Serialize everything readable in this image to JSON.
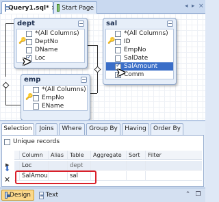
{
  "tabs": [
    {
      "label": "Query1.sql*",
      "icon": "sql-file-icon"
    },
    {
      "label": "Start Page",
      "icon": "start-page-icon"
    }
  ],
  "diagram": {
    "tables": [
      {
        "name": "dept",
        "columns": [
          {
            "label": "*(All Columns)",
            "checked": false,
            "key": false,
            "selected": false
          },
          {
            "label": "DeptNo",
            "checked": false,
            "key": true,
            "selected": false
          },
          {
            "label": "DName",
            "checked": false,
            "key": false,
            "selected": false
          },
          {
            "label": "Loc",
            "checked": true,
            "key": false,
            "selected": false
          }
        ]
      },
      {
        "name": "sal",
        "columns": [
          {
            "label": "*(All Columns)",
            "checked": false,
            "key": false,
            "selected": false
          },
          {
            "label": "ID",
            "checked": false,
            "key": true,
            "selected": false
          },
          {
            "label": "EmpNo",
            "checked": false,
            "key": false,
            "selected": false
          },
          {
            "label": "SalDate",
            "checked": false,
            "key": false,
            "selected": false
          },
          {
            "label": "SalAmount",
            "checked": true,
            "key": false,
            "selected": true
          },
          {
            "label": "Comm",
            "checked": false,
            "key": false,
            "selected": false
          }
        ]
      },
      {
        "name": "emp",
        "columns": [
          {
            "label": "*(All Columns)",
            "checked": false,
            "key": false,
            "selected": false
          },
          {
            "label": "EmpNo",
            "checked": false,
            "key": true,
            "selected": false
          },
          {
            "label": "EName",
            "checked": false,
            "key": false,
            "selected": false
          }
        ]
      }
    ]
  },
  "sub_tabs": [
    "Selection",
    "Joins",
    "Where",
    "Group By",
    "Having",
    "Order By"
  ],
  "active_sub_tab": "Selection",
  "unique_records_label": "Unique records",
  "grid": {
    "headers": [
      "Column",
      "Alias",
      "Table",
      "Aggregate",
      "Sort",
      "Filter"
    ],
    "rows": [
      {
        "column": "Loc",
        "alias": "",
        "table": "dept",
        "aggregate": "",
        "sort": "",
        "filter": ""
      },
      {
        "column": "SalAmount",
        "alias": "",
        "table": "sal",
        "aggregate": "",
        "sort": "",
        "filter": ""
      }
    ]
  },
  "bottom_buttons": {
    "design": "Design",
    "text": "Text"
  },
  "colors": {
    "highlight_box": "#d9202a",
    "selected_row": "#3a6ec8"
  }
}
